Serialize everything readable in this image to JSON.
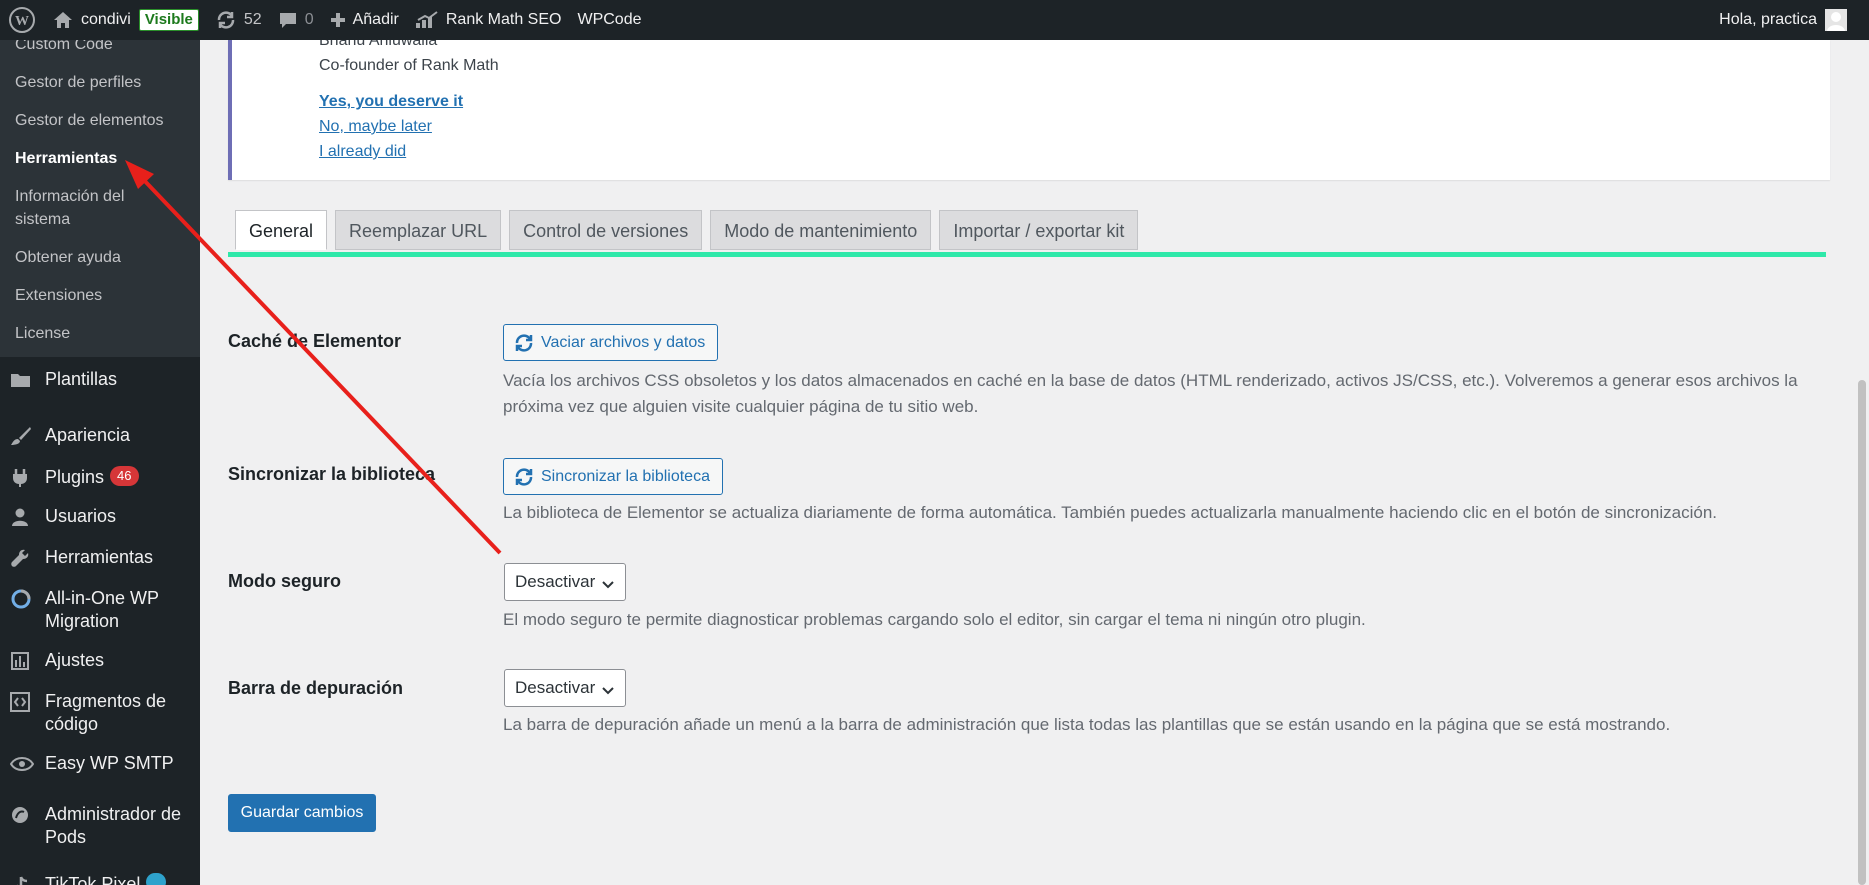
{
  "admin_bar": {
    "site_name": "condivi",
    "visibility_badge": "Visible",
    "updates_count": "52",
    "comments_count": "0",
    "new_label": "Añadir",
    "rank_math_label": "Rank Math SEO",
    "wpcode_label": "WPCode",
    "greeting": "Hola, practica"
  },
  "sidebar": {
    "submenu": [
      {
        "label": "Custom Code"
      },
      {
        "label": "Gestor de perfiles"
      },
      {
        "label": "Gestor de elementos"
      },
      {
        "label": "Herramientas"
      },
      {
        "label": "Información del sistema"
      },
      {
        "label": "Obtener ayuda"
      },
      {
        "label": "Extensiones"
      },
      {
        "label": "License"
      }
    ],
    "menu": [
      {
        "label": "Plantillas",
        "icon": "folder-icon"
      },
      {
        "label": "Apariencia",
        "icon": "paintbrush-icon"
      },
      {
        "label": "Plugins",
        "icon": "plugin-icon",
        "badge": "46"
      },
      {
        "label": "Usuarios",
        "icon": "users-icon"
      },
      {
        "label": "Herramientas",
        "icon": "wrench-icon"
      },
      {
        "label": "All-in-One WP Migration",
        "icon": "migration-icon"
      },
      {
        "label": "Ajustes",
        "icon": "settings-icon"
      },
      {
        "label": "Fragmentos de código",
        "icon": "code-snippets-icon"
      },
      {
        "label": "Easy WP SMTP",
        "icon": "smtp-icon"
      },
      {
        "label": "Administrador de Pods",
        "icon": "pods-icon"
      },
      {
        "label": "TikTok Pixel",
        "icon": "tiktok-icon"
      }
    ]
  },
  "notice": {
    "author_name": "Bhanu Ahluwalia",
    "author_role": "Co-founder of Rank Math",
    "links": [
      "Yes, you deserve it",
      "No, maybe later",
      "I already did"
    ]
  },
  "tabs": [
    "General",
    "Reemplazar URL",
    "Control de versiones",
    "Modo de mantenimiento",
    "Importar / exportar kit"
  ],
  "settings": {
    "cache": {
      "label": "Caché de Elementor",
      "button": "Vaciar archivos y datos",
      "description": "Vacía los archivos CSS obsoletos y los datos almacenados en caché en la base de datos (HTML renderizado, activos JS/CSS, etc.). Volveremos a generar esos archivos la próxima vez que alguien visite cualquier página de tu sitio web."
    },
    "sync": {
      "label": "Sincronizar la biblioteca",
      "button": "Sincronizar la biblioteca",
      "description": "La biblioteca de Elementor se actualiza diariamente de forma automática. También puedes actualizarla manualmente haciendo clic en el botón de sincronización."
    },
    "safe_mode": {
      "label": "Modo seguro",
      "value": "Desactivar",
      "description": "El modo seguro te permite diagnosticar problemas cargando solo el editor, sin cargar el tema ni ningún otro plugin."
    },
    "debug_bar": {
      "label": "Barra de depuración",
      "value": "Desactivar",
      "description": "La barra de depuración añade un menú a la barra de administración que lista todas las plantillas que se están usando en la página que se está mostrando."
    },
    "save_label": "Guardar cambios"
  },
  "colors": {
    "accent": "#2271b1",
    "tab_rule": "#2ee8a9",
    "annotation_arrow": "#e8201b"
  }
}
